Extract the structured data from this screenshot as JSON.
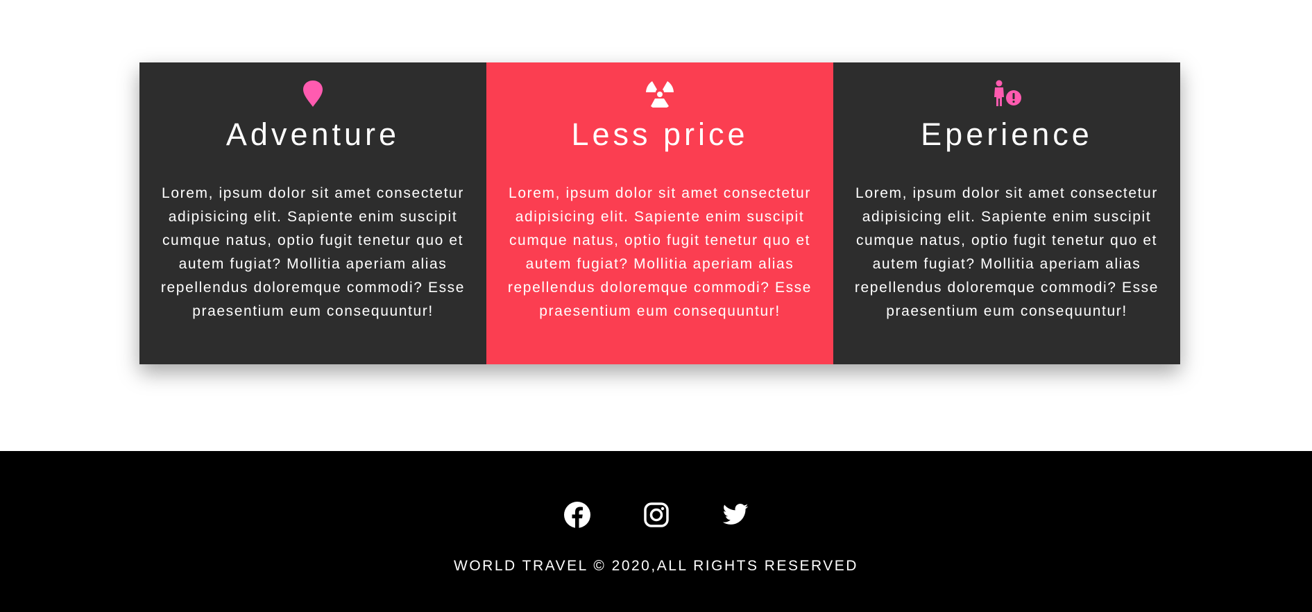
{
  "colors": {
    "card_dark": "#2d2d2d",
    "card_accent": "#fb3e51",
    "icon_pink": "#ff5bb0",
    "footer_bg": "#000000"
  },
  "features": [
    {
      "icon": "map-pin-icon",
      "title": "Adventure",
      "text": "Lorem, ipsum dolor sit amet consectetur adipisicing elit. Sapiente enim suscipit cumque natus, optio fugit tenetur quo et autem fugiat? Mollitia aperiam alias repellendus doloremque commodi? Esse praesentium eum consequuntur!"
    },
    {
      "icon": "radiation-icon",
      "title": "Less price",
      "text": "Lorem, ipsum dolor sit amet consectetur adipisicing elit. Sapiente enim suscipit cumque natus, optio fugit tenetur quo et autem fugiat? Mollitia aperiam alias repellendus doloremque commodi? Esse praesentium eum consequuntur!"
    },
    {
      "icon": "person-exclamation-icon",
      "title": "Eperience",
      "text": "Lorem, ipsum dolor sit amet consectetur adipisicing elit. Sapiente enim suscipit cumque natus, optio fugit tenetur quo et autem fugiat? Mollitia aperiam alias repellendus doloremque commodi? Esse praesentium eum consequuntur!"
    }
  ],
  "footer": {
    "social_icons": [
      "facebook-icon",
      "instagram-icon",
      "twitter-icon"
    ],
    "copyright": "WORLD TRAVEL © 2020,ALL RIGHTS RESERVED"
  }
}
